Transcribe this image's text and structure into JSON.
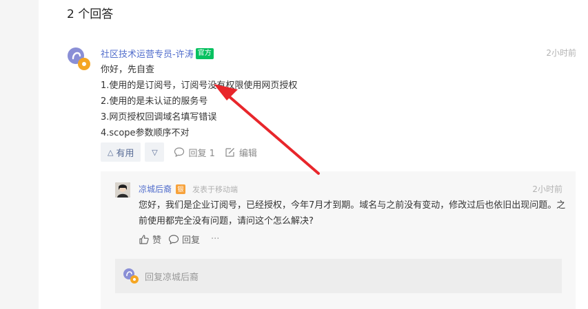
{
  "answers": {
    "count_label": "2 个回答"
  },
  "answer": {
    "author": "社区技术运营专员-许涛",
    "badge": "官方",
    "time": "2小时前",
    "lines": [
      "你好，先自查",
      "1.使用的是订阅号，订阅号没有权限使用网页授权",
      "2.使用的是未认证的服务号",
      "3.网页授权回调域名填写错误",
      "4.scope参数顺序不对"
    ],
    "actions": {
      "useful": "有用",
      "reply": "回复 1",
      "edit": "编辑"
    }
  },
  "reply": {
    "author": "凉城后裔",
    "level_badge": "银",
    "source": "发表于移动端",
    "time": "2小时前",
    "text": "您好，我们是企业订阅号，已经授权，今年7月才到期。域名与之前没有变动，修改过后也依旧出现问题。之前使用都完全没有问题，请问这个怎么解决?",
    "actions": {
      "like": "赞",
      "reply": "回复",
      "more": "···"
    }
  },
  "reply_input": {
    "placeholder": "回复凉城后裔"
  },
  "colors": {
    "link": "#526ecc",
    "official": "#07c160",
    "annotation_arrow": "#e8262b"
  }
}
